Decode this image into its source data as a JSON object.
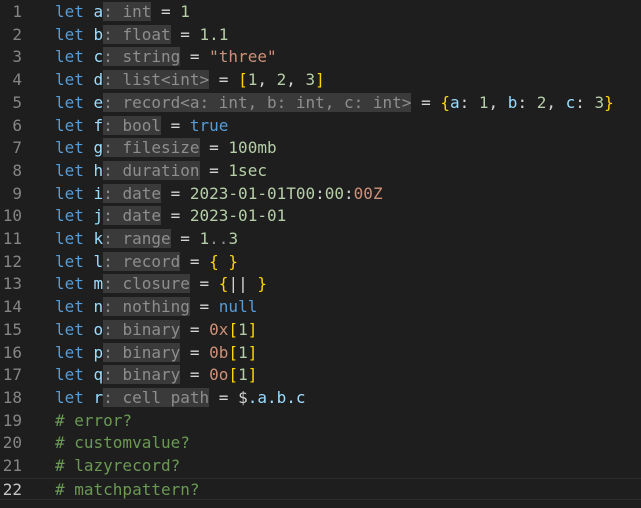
{
  "editor": {
    "lines": [
      {
        "num": "1",
        "tokens": [
          {
            "t": "let",
            "c": "kw"
          },
          {
            "t": " "
          },
          {
            "t": "a",
            "c": "var"
          },
          {
            "t": ": int",
            "c": "type"
          },
          {
            "t": " = ",
            "c": "op"
          },
          {
            "t": "1",
            "c": "num"
          }
        ]
      },
      {
        "num": "2",
        "tokens": [
          {
            "t": "let",
            "c": "kw"
          },
          {
            "t": " "
          },
          {
            "t": "b",
            "c": "var"
          },
          {
            "t": ": float",
            "c": "type"
          },
          {
            "t": " = ",
            "c": "op"
          },
          {
            "t": "1.1",
            "c": "num"
          }
        ]
      },
      {
        "num": "3",
        "tokens": [
          {
            "t": "let",
            "c": "kw"
          },
          {
            "t": " "
          },
          {
            "t": "c",
            "c": "var"
          },
          {
            "t": ": string",
            "c": "type"
          },
          {
            "t": " = ",
            "c": "op"
          },
          {
            "t": "\"three\"",
            "c": "str"
          }
        ]
      },
      {
        "num": "4",
        "tokens": [
          {
            "t": "let",
            "c": "kw"
          },
          {
            "t": " "
          },
          {
            "t": "d",
            "c": "var"
          },
          {
            "t": ": list<int>",
            "c": "type"
          },
          {
            "t": " = ",
            "c": "op"
          },
          {
            "t": "[",
            "c": "br"
          },
          {
            "t": "1",
            "c": "num"
          },
          {
            "t": ", ",
            "c": "op"
          },
          {
            "t": "2",
            "c": "num"
          },
          {
            "t": ", ",
            "c": "op"
          },
          {
            "t": "3",
            "c": "num"
          },
          {
            "t": "]",
            "c": "br"
          }
        ]
      },
      {
        "num": "5",
        "tokens": [
          {
            "t": "let",
            "c": "kw"
          },
          {
            "t": " "
          },
          {
            "t": "e",
            "c": "var"
          },
          {
            "t": ": record<a: int, b: int, c: int>",
            "c": "type"
          },
          {
            "t": " = ",
            "c": "op"
          },
          {
            "t": "{",
            "c": "br"
          },
          {
            "t": "a",
            "c": "var"
          },
          {
            "t": ": ",
            "c": "op"
          },
          {
            "t": "1",
            "c": "num"
          },
          {
            "t": ", ",
            "c": "op"
          },
          {
            "t": "b",
            "c": "var"
          },
          {
            "t": ": ",
            "c": "op"
          },
          {
            "t": "2",
            "c": "num"
          },
          {
            "t": ", ",
            "c": "op"
          },
          {
            "t": "c",
            "c": "var"
          },
          {
            "t": ": ",
            "c": "op"
          },
          {
            "t": "3",
            "c": "num"
          },
          {
            "t": "}",
            "c": "br"
          }
        ]
      },
      {
        "num": "6",
        "tokens": [
          {
            "t": "let",
            "c": "kw"
          },
          {
            "t": " "
          },
          {
            "t": "f",
            "c": "var"
          },
          {
            "t": ": bool",
            "c": "type"
          },
          {
            "t": " = ",
            "c": "op"
          },
          {
            "t": "true",
            "c": "bool"
          }
        ]
      },
      {
        "num": "7",
        "tokens": [
          {
            "t": "let",
            "c": "kw"
          },
          {
            "t": " "
          },
          {
            "t": "g",
            "c": "var"
          },
          {
            "t": ": filesize",
            "c": "type"
          },
          {
            "t": " = ",
            "c": "op"
          },
          {
            "t": "100mb",
            "c": "num"
          }
        ]
      },
      {
        "num": "8",
        "tokens": [
          {
            "t": "let",
            "c": "kw"
          },
          {
            "t": " "
          },
          {
            "t": "h",
            "c": "var"
          },
          {
            "t": ": duration",
            "c": "type"
          },
          {
            "t": " = ",
            "c": "op"
          },
          {
            "t": "1sec",
            "c": "num"
          }
        ]
      },
      {
        "num": "9",
        "tokens": [
          {
            "t": "let",
            "c": "kw"
          },
          {
            "t": " "
          },
          {
            "t": "i",
            "c": "var"
          },
          {
            "t": ": date",
            "c": "type"
          },
          {
            "t": " = ",
            "c": "op"
          },
          {
            "t": "2023-01-01T00",
            "c": "date"
          },
          {
            "t": ":",
            "c": "op"
          },
          {
            "t": "00",
            "c": "date"
          },
          {
            "t": ":",
            "c": "op"
          },
          {
            "t": "00Z",
            "c": "str"
          }
        ]
      },
      {
        "num": "10",
        "tokens": [
          {
            "t": "let",
            "c": "kw"
          },
          {
            "t": " "
          },
          {
            "t": "j",
            "c": "var"
          },
          {
            "t": ": date",
            "c": "type"
          },
          {
            "t": " = ",
            "c": "op"
          },
          {
            "t": "2023-01-01",
            "c": "date"
          }
        ]
      },
      {
        "num": "11",
        "tokens": [
          {
            "t": "let",
            "c": "kw"
          },
          {
            "t": " "
          },
          {
            "t": "k",
            "c": "var"
          },
          {
            "t": ": range",
            "c": "type"
          },
          {
            "t": " = ",
            "c": "op"
          },
          {
            "t": "1",
            "c": "num"
          },
          {
            "t": "..",
            "c": "dim"
          },
          {
            "t": "3",
            "c": "num"
          }
        ]
      },
      {
        "num": "12",
        "tokens": [
          {
            "t": "let",
            "c": "kw"
          },
          {
            "t": " "
          },
          {
            "t": "l",
            "c": "var"
          },
          {
            "t": ": record",
            "c": "type"
          },
          {
            "t": " = ",
            "c": "op"
          },
          {
            "t": "{ }",
            "c": "br"
          }
        ]
      },
      {
        "num": "13",
        "tokens": [
          {
            "t": "let",
            "c": "kw"
          },
          {
            "t": " "
          },
          {
            "t": "m",
            "c": "var"
          },
          {
            "t": ": closure",
            "c": "type"
          },
          {
            "t": " = ",
            "c": "op"
          },
          {
            "t": "{",
            "c": "br"
          },
          {
            "t": "||",
            "c": "op"
          },
          {
            "t": " }",
            "c": "br"
          }
        ]
      },
      {
        "num": "14",
        "tokens": [
          {
            "t": "let",
            "c": "kw"
          },
          {
            "t": " "
          },
          {
            "t": "n",
            "c": "var"
          },
          {
            "t": ": nothing",
            "c": "type"
          },
          {
            "t": " = ",
            "c": "op"
          },
          {
            "t": "null",
            "c": "bool"
          }
        ]
      },
      {
        "num": "15",
        "tokens": [
          {
            "t": "let",
            "c": "kw"
          },
          {
            "t": " "
          },
          {
            "t": "o",
            "c": "var"
          },
          {
            "t": ": binary",
            "c": "type"
          },
          {
            "t": " = ",
            "c": "op"
          },
          {
            "t": "0x",
            "c": "str"
          },
          {
            "t": "[",
            "c": "br"
          },
          {
            "t": "1",
            "c": "num"
          },
          {
            "t": "]",
            "c": "br"
          }
        ]
      },
      {
        "num": "16",
        "tokens": [
          {
            "t": "let",
            "c": "kw"
          },
          {
            "t": " "
          },
          {
            "t": "p",
            "c": "var"
          },
          {
            "t": ": binary",
            "c": "type"
          },
          {
            "t": " = ",
            "c": "op"
          },
          {
            "t": "0b",
            "c": "str"
          },
          {
            "t": "[",
            "c": "br"
          },
          {
            "t": "1",
            "c": "num"
          },
          {
            "t": "]",
            "c": "br"
          }
        ]
      },
      {
        "num": "17",
        "tokens": [
          {
            "t": "let",
            "c": "kw"
          },
          {
            "t": " "
          },
          {
            "t": "q",
            "c": "var"
          },
          {
            "t": ": binary",
            "c": "type"
          },
          {
            "t": " = ",
            "c": "op"
          },
          {
            "t": "0o",
            "c": "str"
          },
          {
            "t": "[",
            "c": "br"
          },
          {
            "t": "1",
            "c": "num"
          },
          {
            "t": "]",
            "c": "br"
          }
        ]
      },
      {
        "num": "18",
        "tokens": [
          {
            "t": "let",
            "c": "kw"
          },
          {
            "t": " "
          },
          {
            "t": "r",
            "c": "var"
          },
          {
            "t": ": cell path",
            "c": "type"
          },
          {
            "t": " = ",
            "c": "op"
          },
          {
            "t": "$",
            "c": "op"
          },
          {
            "t": ".a.b.c",
            "c": "path"
          }
        ]
      },
      {
        "num": "19",
        "tokens": [
          {
            "t": "# error?",
            "c": "cmt"
          }
        ]
      },
      {
        "num": "20",
        "tokens": [
          {
            "t": "# customvalue?",
            "c": "cmt"
          }
        ]
      },
      {
        "num": "21",
        "tokens": [
          {
            "t": "# lazyrecord?",
            "c": "cmt"
          }
        ]
      },
      {
        "num": "22",
        "tokens": [
          {
            "t": "# matchpattern?",
            "c": "cmt"
          }
        ],
        "current": true
      }
    ]
  }
}
